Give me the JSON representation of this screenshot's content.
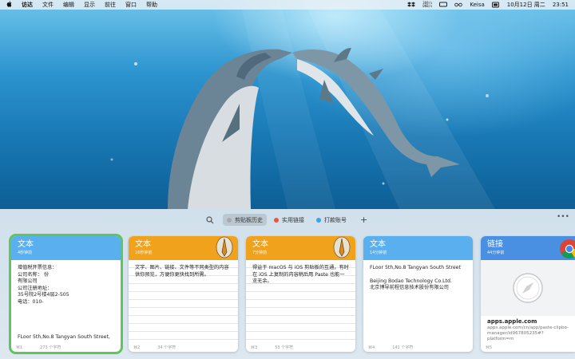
{
  "menubar": {
    "app_name": "访达",
    "menus": [
      "文件",
      "编辑",
      "显示",
      "前往",
      "窗口",
      "帮助"
    ],
    "stats_line1": "369/s",
    "stats_line2": "0KB/s",
    "user": "Keisa",
    "datetime": "10月12日 周二",
    "time": "23:51"
  },
  "toolbar": {
    "tabs": [
      {
        "label": "剪贴板历史",
        "color": "#a9a9ad",
        "active": true
      },
      {
        "label": "实用链接",
        "color": "#e8553e",
        "active": false
      },
      {
        "label": "打款账号",
        "color": "#3aa3e8",
        "active": false
      }
    ],
    "add": "+",
    "more": "•••"
  },
  "cards": [
    {
      "type": "文本",
      "time": "4秒钟前",
      "color": "#5ab0ee",
      "body_lines": [
        "增值税开票信息：",
        "公司名称：                                          份",
        "有限公司",
        "公司注册地址：",
        "35号院2号楼4层2-505",
        "电话：010-",
        "",
        "",
        "",
        "",
        "FLoor 5th,No.8 Tangyan South Street,"
      ],
      "index": "⌘1",
      "count": "273 个字符"
    },
    {
      "type": "文本",
      "time": "16秒钟前",
      "color": "#f0a21c",
      "body_lines": [
        "文字、图片、链接、文件等不同类型的内容供你预览，方便你更快找到所需。"
      ],
      "index": "⌘2",
      "count": "34 个字符"
    },
    {
      "type": "文本",
      "time": "7分钟前",
      "color": "#f0a21c",
      "body_lines": [
        "得益于 macOS 与 iOS 剪贴板的互通，有时在 iOS 上复制的内容稍后用 Paste 也能一览无余。"
      ],
      "index": "⌘3",
      "count": "53 个字符"
    },
    {
      "type": "文本",
      "time": "14分钟前",
      "color": "#5ab0ee",
      "body_lines": [
        "FLoor 5th,No.8 Tangyan South Street",
        "",
        "Beijing Bodao Technology Co.Ltd.",
        "北京博导前程信息技术股份有限公司"
      ],
      "index": "⌘4",
      "count": "141 个字符"
    },
    {
      "type": "链接",
      "time": "44分钟前",
      "color": "#4a90e2",
      "link_title": "apps.apple.com",
      "link_url": "apps.apple.com/cn/app/paste-clipbo-manager/id967805235#?platform=m",
      "index": "⌘5"
    }
  ]
}
